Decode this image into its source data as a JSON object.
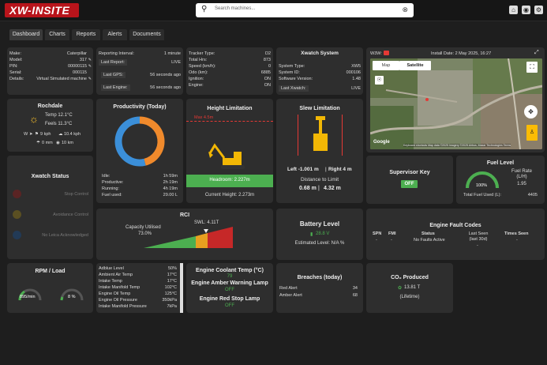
{
  "header": {
    "logo_text": "XW-INSITE",
    "search_placeholder": "Search machines...",
    "icons": [
      "home-icon",
      "globe-icon",
      "settings-icon"
    ]
  },
  "tabs": [
    "Dashboard",
    "Charts",
    "Reports",
    "Alerts",
    "Documents"
  ],
  "machine": {
    "make_label": "Make:",
    "make": "Caterpillar",
    "model_label": "Model:",
    "model": "317",
    "pin_label": "PIN:",
    "pin": "00000115",
    "serial_label": "Serial:",
    "serial": "000115",
    "details_label": "Details:",
    "details": "Virtual Simulated machine"
  },
  "reporting": {
    "interval_label": "Reporting Interval:",
    "interval": "1 minute",
    "last_report_label": "Last Report:",
    "last_report": "LIVE",
    "last_gps_label": "Last GPS:",
    "last_gps": "56 seconds ago",
    "last_engine_label": "Last Engine:",
    "last_engine": "56 seconds ago"
  },
  "tracker": {
    "type_label": "Tracker Type:",
    "type": "D2",
    "hrs_label": "Total Hrs:",
    "hrs": "873",
    "speed_label": "Speed (km/h):",
    "speed": "0",
    "odo_label": "Odo (km):",
    "odo": "6885",
    "ignition_label": "Ignition:",
    "ignition": "ON",
    "engine_label": "Engine:",
    "engine": "ON"
  },
  "xwatch_system": {
    "title": "Xwatch System",
    "type_label": "System Type:",
    "type": "XW5",
    "id_label": "System ID:",
    "id": "000106",
    "version_label": "Software Version:",
    "version": "1.48",
    "last_label": "Last Xwatch:",
    "last": "LIVE"
  },
  "map": {
    "w3w_label": "W3W:",
    "install_date": "Install Date: 2 May 2025, 16:27",
    "map_tab": "Map",
    "satellite_tab": "Satellite",
    "google": "Google",
    "attribution": "Keyboard shortcuts   Map data ©2025 Imagery ©2025 Airbus, Maxar Technologies   Terms"
  },
  "weather": {
    "title": "Rochdale",
    "temp": "Temp 12.1°C",
    "feels": "Feels 11.3°C",
    "wind_dir": "W",
    "wind_speed": "9 kph",
    "gust": "10.4 kph",
    "rain": "0 mm",
    "visibility": "10 km"
  },
  "productivity": {
    "title": "Productivity (Today)",
    "idle_label": "Idle:",
    "idle": "1h 59m",
    "productive_label": "Productive:",
    "productive": "2h 19m",
    "running_label": "Running:",
    "running": "4h 19m",
    "fuel_label": "Fuel used:",
    "fuel": "29.00 L",
    "chart_data": {
      "type": "pie",
      "categories": [
        "Idle",
        "Productive"
      ],
      "values": [
        119,
        139
      ],
      "colors": [
        "#f08a2c",
        "#3b8fd9"
      ]
    }
  },
  "height": {
    "title": "Height Limitation",
    "max": "Max 4.5m",
    "headroom": "Headroom: 2.227m",
    "current": "Current Height: 2.273m"
  },
  "slew": {
    "title": "Slew Limitation",
    "left": "Left -1.001 m",
    "right": "Right 4 m",
    "distance_label": "Distance to Limit",
    "distance_left": "0.68 m",
    "distance_right": "4.32 m"
  },
  "supervisor": {
    "title": "Supervisor Key",
    "state": "OFF"
  },
  "fuel": {
    "title": "Fuel Level",
    "rate_label": "Fuel Rate\n(L/H)",
    "rate": "1.95",
    "percent": "100%",
    "level": 1.0,
    "total_label": "Total Fuel Used (L):",
    "total": "4405"
  },
  "xwatch_status": {
    "title": "Xwatch Status",
    "items": [
      "Stop Control",
      "Avoidance Control",
      "No Leica Acknowledged"
    ]
  },
  "rci": {
    "title": "RCI",
    "capacity_label": "Capacity Utilised",
    "capacity": "73.0%",
    "swl": "SWL: 4.11T"
  },
  "battery": {
    "title": "Battery Level",
    "voltage": "28.8 V",
    "estimated": "Estimated Level: N/A %"
  },
  "faults": {
    "title": "Engine Fault Codes",
    "headers": [
      "SPN",
      "FMI",
      "Status",
      "Last Seen\n(last 30d)",
      "Times Seen"
    ],
    "row": [
      "-",
      "-",
      "No Faults Active",
      "-",
      "-"
    ]
  },
  "rpm": {
    "title": "RPM / Load",
    "rpm": "895/min",
    "load": "8 %"
  },
  "sensors": [
    [
      "Adblue Level",
      "50%"
    ],
    [
      "Ambient Air Temp",
      "17°C"
    ],
    [
      "Intake Temp",
      "17°C"
    ],
    [
      "Intake Manifold Temp",
      "102°C"
    ],
    [
      "Engine Oil Temp",
      "125°C"
    ],
    [
      "Engine Oil Pressure",
      "350kPa"
    ],
    [
      "Intake Manifold Pressure",
      "7kPa"
    ]
  ],
  "engine_status": {
    "coolant_label": "Engine Coolant Temp (°C)",
    "coolant": "79",
    "amber_label": "Engine Amber Warning Lamp",
    "amber": "OFF",
    "red_label": "Engine Red Stop Lamp",
    "red": "OFF"
  },
  "breaches": {
    "title": "Breaches (today)",
    "red_label": "Red Alert",
    "red": "34",
    "amber_label": "Amber Alert",
    "amber": "68"
  },
  "co2": {
    "title": "CO₂ Produced",
    "value": "13.81 T",
    "period": "(Lifetime)"
  },
  "colors": {
    "accent_red": "#e53935",
    "green": "#4caf50",
    "orange": "#f08a2c",
    "blue": "#3b8fd9"
  }
}
